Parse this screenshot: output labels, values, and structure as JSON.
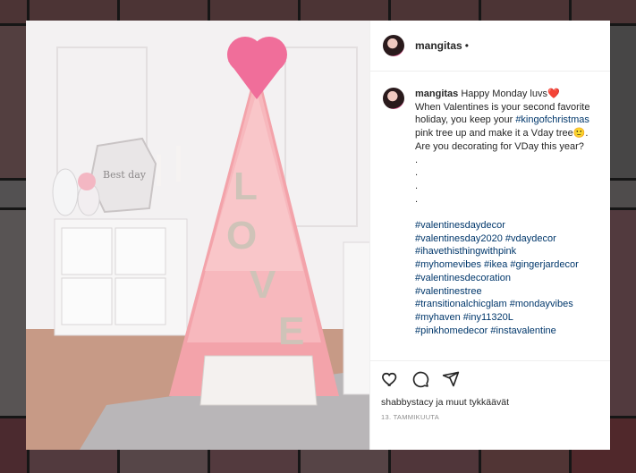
{
  "post": {
    "username": "mangitas",
    "follow_dot": "•",
    "caption_text": "Happy Monday luvs❤️\nWhen Valentines is your second favorite holiday, you keep your ",
    "caption_tag1": "#kingofchristmas",
    "caption_text2": " pink tree up and make it a Vday tree🙂. Are you decorating for VDay this year?\n.\n.\n.\n.\n\n",
    "hashtags": [
      "#valentinesdaydecor",
      "#valentinesday2020 #vdaydecor",
      "#ihavethisthingwithpink",
      "#myhomevibes #ikea #gingerjardecor",
      "#valentinesdecoration",
      "#valentinestree",
      "#transitionalchicglam #mondayvibes",
      "#myhaven #iny11320L",
      "#pinkhomedecor #instavalentine"
    ],
    "likes_text": "shabbystacy ja muut tykkäävät",
    "date": "13. TAMMIKUUTA"
  },
  "photo": {
    "sign_text": "Best day",
    "letters": [
      "L",
      "O",
      "V",
      "E"
    ]
  }
}
